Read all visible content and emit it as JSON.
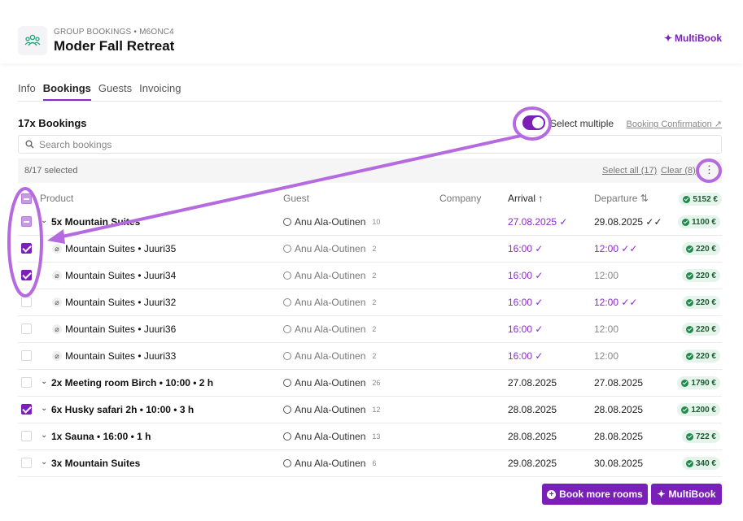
{
  "header": {
    "eyebrow": "GROUP BOOKINGS • M6ONC4",
    "title": "Moder Fall Retreat",
    "multibook_label": "MultiBook"
  },
  "tabs": [
    {
      "label": "Info",
      "active": false
    },
    {
      "label": "Bookings",
      "active": true
    },
    {
      "label": "Guests",
      "active": false
    },
    {
      "label": "Invoicing",
      "active": false
    }
  ],
  "bookings": {
    "count_label": "17x Bookings",
    "select_multiple_label": "Select multiple",
    "select_multiple_on": true,
    "booking_confirmation_label": "Booking Confirmation ↗",
    "search_placeholder": "Search bookings",
    "selected_text": "8/17 selected",
    "select_all_label": "Select all (17)",
    "clear_label": "Clear (8)"
  },
  "columns": {
    "product": "Product",
    "guest": "Guest",
    "company": "Company",
    "arrival": "Arrival ↑",
    "departure": "Departure ⇅",
    "total": "5152 €"
  },
  "rows": [
    {
      "product": "5x Mountain Suites",
      "guest": "Anu Ala-Outinen",
      "pax": "10",
      "arrival": "27.08.2025 ✓",
      "departure": "29.08.2025 ✓✓",
      "price": "1100 €"
    },
    {
      "product": "Mountain Suites • Juuri35",
      "guest": "Anu Ala-Outinen",
      "pax": "2",
      "arrival": "16:00 ✓",
      "departure": "12:00 ✓✓",
      "price": "220 €"
    },
    {
      "product": "Mountain Suites • Juuri34",
      "guest": "Anu Ala-Outinen",
      "pax": "2",
      "arrival": "16:00 ✓",
      "departure": "12:00",
      "price": "220 €"
    },
    {
      "product": "Mountain Suites • Juuri32",
      "guest": "Anu Ala-Outinen",
      "pax": "2",
      "arrival": "16:00 ✓",
      "departure": "12:00 ✓✓",
      "price": "220 €"
    },
    {
      "product": "Mountain Suites • Juuri36",
      "guest": "Anu Ala-Outinen",
      "pax": "2",
      "arrival": "16:00 ✓",
      "departure": "12:00",
      "price": "220 €"
    },
    {
      "product": "Mountain Suites • Juuri33",
      "guest": "Anu Ala-Outinen",
      "pax": "2",
      "arrival": "16:00 ✓",
      "departure": "12:00",
      "price": "220 €"
    },
    {
      "product": "2x Meeting room Birch • 10:00 • 2 h",
      "guest": "Anu Ala-Outinen",
      "pax": "26",
      "arrival": "27.08.2025",
      "departure": "27.08.2025",
      "price": "1790 €"
    },
    {
      "product": "6x Husky safari 2h • 10:00 • 3 h",
      "guest": "Anu Ala-Outinen",
      "pax": "12",
      "arrival": "28.08.2025",
      "departure": "28.08.2025",
      "price": "1200 €"
    },
    {
      "product": "1x Sauna • 16:00 • 1 h",
      "guest": "Anu Ala-Outinen",
      "pax": "13",
      "arrival": "28.08.2025",
      "departure": "28.08.2025",
      "price": "722 €"
    },
    {
      "product": "3x Mountain Suites",
      "guest": "Anu Ala-Outinen",
      "pax": "6",
      "arrival": "29.08.2025",
      "departure": "30.08.2025",
      "price": "340 €"
    }
  ],
  "footer": {
    "book_more_label": "Book more rooms",
    "multibook_label": "MultiBook"
  },
  "colors": {
    "accent": "#7a1fb8",
    "annotation": "#b56ae0",
    "price_badge": "#e5f4ea"
  }
}
